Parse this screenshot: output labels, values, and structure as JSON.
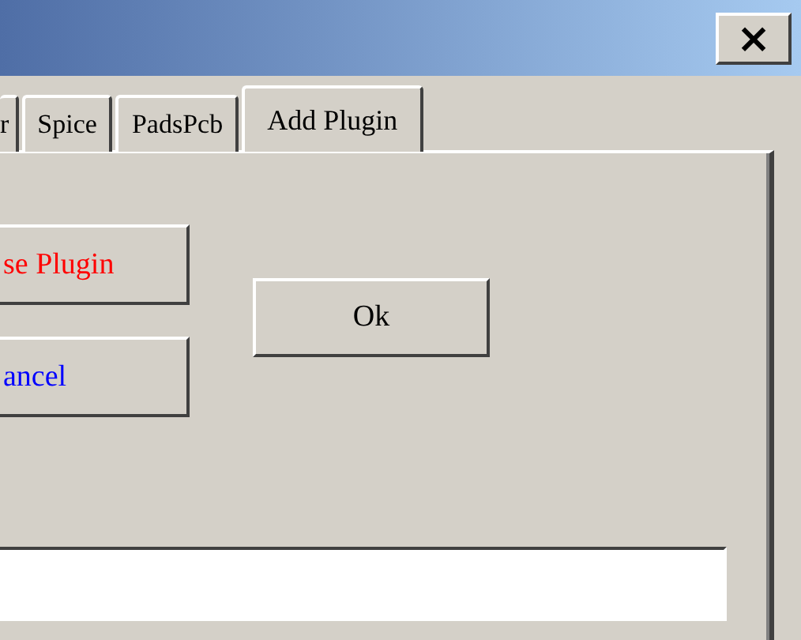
{
  "window": {
    "close_label": "×"
  },
  "tabs": [
    {
      "label": "r",
      "selected": false
    },
    {
      "label": "Spice",
      "selected": false
    },
    {
      "label": "PadsPcb",
      "selected": false
    },
    {
      "label": "Add Plugin",
      "selected": true
    }
  ],
  "buttons": [
    {
      "label": "se Plugin",
      "color": "#ff0000"
    },
    {
      "label": "ancel",
      "color": "#0000ff"
    }
  ],
  "ok_button": {
    "label": "Ok"
  }
}
